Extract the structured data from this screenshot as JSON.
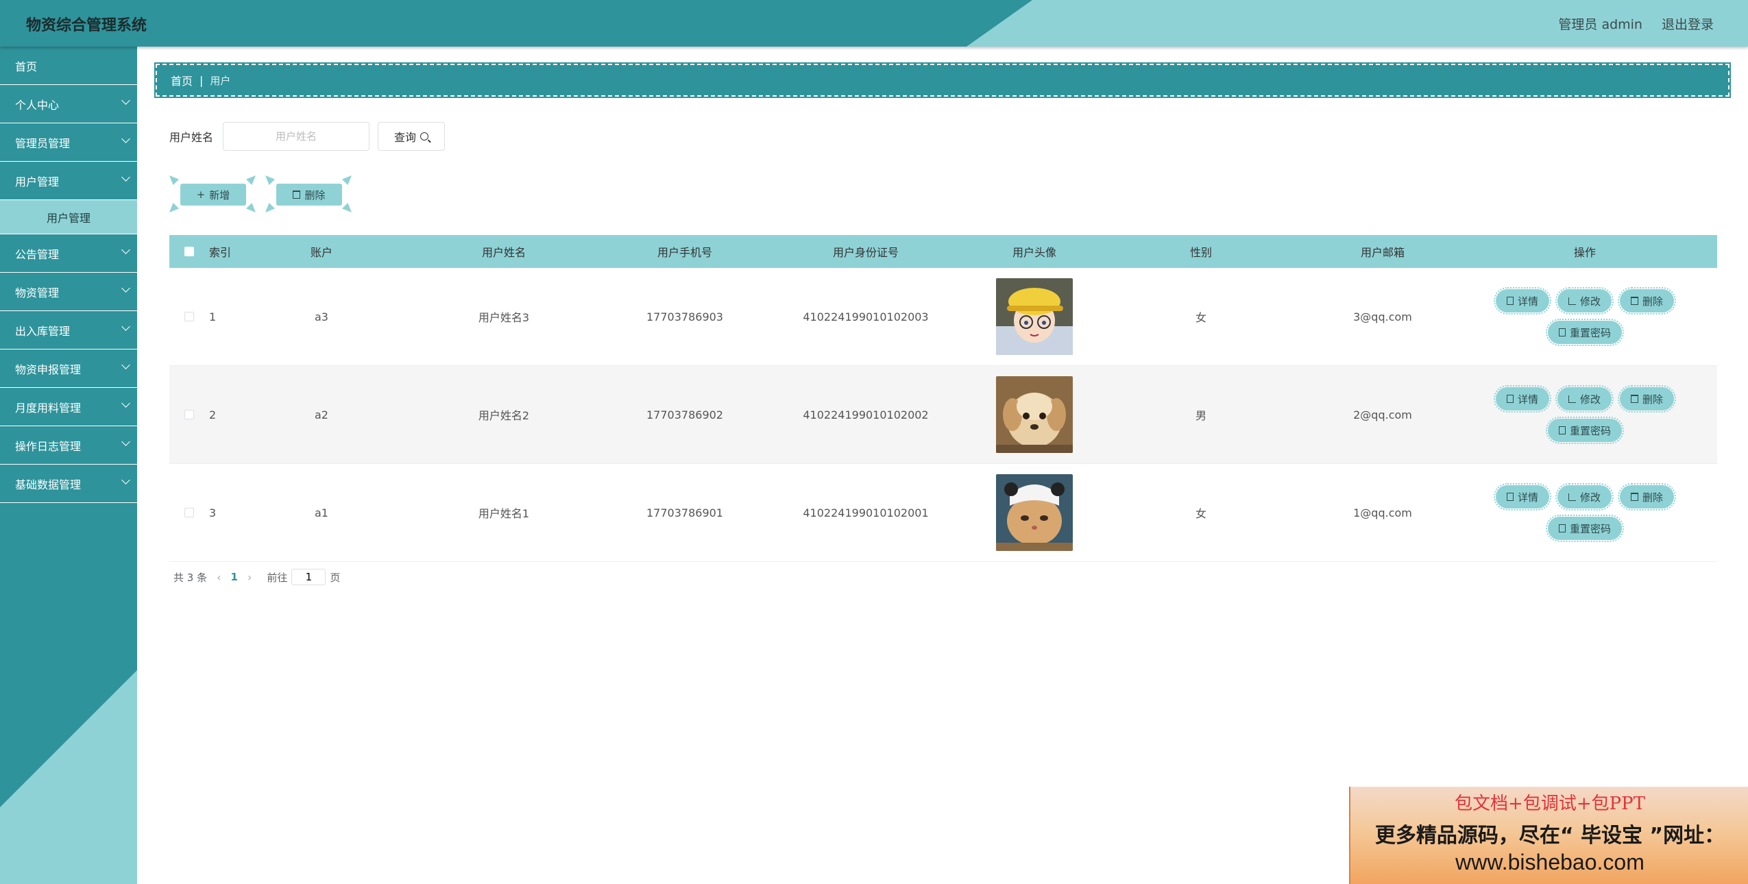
{
  "header": {
    "title": "物资综合管理系统",
    "user_label": "管理员 admin",
    "logout_label": "退出登录"
  },
  "sidebar": {
    "items": [
      {
        "label": "首页"
      },
      {
        "label": "个人中心"
      },
      {
        "label": "管理员管理"
      },
      {
        "label": "用户管理"
      },
      {
        "label": "公告管理"
      },
      {
        "label": "物资管理"
      },
      {
        "label": "出入库管理"
      },
      {
        "label": "物资申报管理"
      },
      {
        "label": "月度用料管理"
      },
      {
        "label": "操作日志管理"
      },
      {
        "label": "基础数据管理"
      }
    ],
    "active_sub": "用户管理"
  },
  "breadcrumb": {
    "home": "首页",
    "sep": "|",
    "current": "用户"
  },
  "search": {
    "label": "用户姓名",
    "placeholder": "用户姓名",
    "value": "",
    "button_label": "查询"
  },
  "actions": {
    "add_label": "新增",
    "delete_label": "删除"
  },
  "table": {
    "columns": [
      "索引",
      "账户",
      "用户姓名",
      "用户手机号",
      "用户身份证号",
      "用户头像",
      "性别",
      "用户邮箱",
      "操作"
    ],
    "rows": [
      {
        "index": "1",
        "account": "a3",
        "name": "用户姓名3",
        "phone": "17703786903",
        "id_no": "410224199010102003",
        "avatar": "cartoon-boy-avatar",
        "sex": "女",
        "email": "3@qq.com"
      },
      {
        "index": "2",
        "account": "a2",
        "name": "用户姓名2",
        "phone": "17703786902",
        "id_no": "410224199010102002",
        "avatar": "puppy-avatar",
        "sex": "男",
        "email": "2@qq.com"
      },
      {
        "index": "3",
        "account": "a1",
        "name": "用户姓名1",
        "phone": "17703786901",
        "id_no": "410224199010102001",
        "avatar": "kitten-avatar",
        "sex": "女",
        "email": "1@qq.com"
      }
    ],
    "row_actions": {
      "detail": "详情",
      "edit": "修改",
      "delete": "删除",
      "reset_password": "重置密码"
    }
  },
  "pagination": {
    "total_text": "共 3 条",
    "current_page": "1",
    "goto_label": "前往",
    "goto_value": "1",
    "page_suffix": "页"
  },
  "ad": {
    "line1": "包文档+包调试+包PPT",
    "line2": "更多精品源码，尽在“ 毕设宝 ”网址：",
    "line3": "www.bishebao.com"
  },
  "colors": {
    "primary": "#2e939b",
    "accent": "#8fd2d6"
  }
}
